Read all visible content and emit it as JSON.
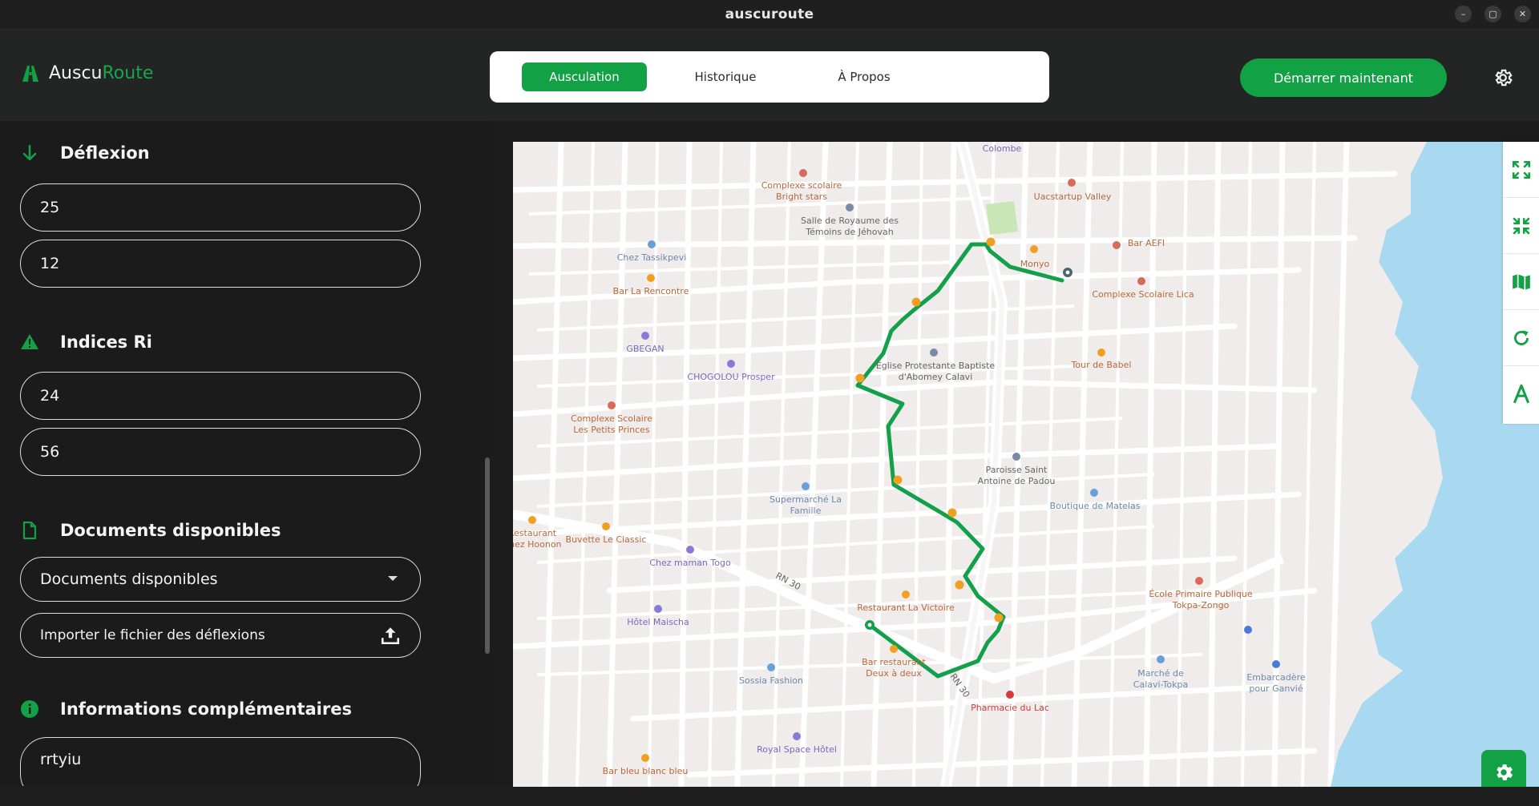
{
  "window": {
    "title": "auscuroute",
    "controls": [
      "–",
      "▢",
      "✕"
    ]
  },
  "brand": {
    "name_part1": "Auscu",
    "name_part2": "Route"
  },
  "nav": {
    "tabs": [
      {
        "label": "Ausculation",
        "active": true
      },
      {
        "label": "Historique",
        "active": false
      },
      {
        "label": "À Propos",
        "active": false
      }
    ]
  },
  "header": {
    "start_label": "Démarrer maintenant",
    "settings_icon": "gear-icon"
  },
  "sidebar": {
    "deflexion": {
      "title": "Déflexion",
      "values": [
        "25",
        "12"
      ]
    },
    "indices": {
      "title": "Indices Ri",
      "values": [
        "24",
        "56"
      ]
    },
    "documents": {
      "title": "Documents disponibles",
      "select_value": "Documents disponibles",
      "import_label": "Importer le fichier des déflexions"
    },
    "infos": {
      "title": "Informations complémentaires",
      "value": "rrtyiu"
    }
  },
  "map": {
    "labels": [
      "Colombe",
      "Complexe scolaire Bright stars",
      "Uacstartup Valley",
      "Salle de Royaume des Témoins de Jéhovah",
      "Bar AEFI",
      "Monyo",
      "Chez Tassikpevi",
      "Bar La Rencontre",
      "Complexe Scolaire Lica",
      "GBEGAN",
      "CHOGOLOU Prosper",
      "Église Protestante Baptiste d'Abomey Calavi",
      "Tour de Babel",
      "Complexe Scolaire Les Petits Princes",
      "Paroisse Saint Antoine de Padou",
      "Supermarché La Famille",
      "Boutique de Matelas",
      "Restaurant Chez Hoonon",
      "Buvette Le Classic",
      "Chez maman Togo",
      "RN 30",
      "École Primaire Publique Tokpa-Zongo",
      "Hôtel Maischa",
      "Restaurant La Victoire",
      "Bar restaurant Deux à deux",
      "Sossia Fashion",
      "Marché de Calavi-Tokpa",
      "Embarcadère pour Ganvié",
      "Pharmacie du Lac",
      "Royal Space Hôtel",
      "Bar bleu blanc bleu",
      "RN 30"
    ],
    "tools": [
      "expand-icon",
      "collapse-icon",
      "map-icon",
      "refresh-icon",
      "text-icon"
    ]
  },
  "colors": {
    "accent": "#12a144",
    "route": "#13a04a",
    "water": "#a9d9f0"
  }
}
